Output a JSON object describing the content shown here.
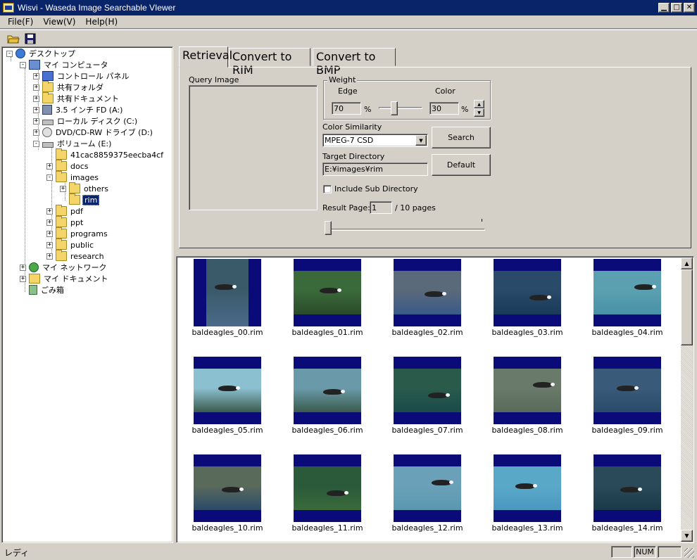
{
  "window": {
    "title": "Wisvi - Waseda Image Searchable VIewer"
  },
  "menu": [
    "File(F)",
    "View(V)",
    "Help(H)"
  ],
  "toolbar": {
    "buttons": [
      "open-folder-icon",
      "save-icon"
    ]
  },
  "tree": [
    {
      "label": "デスクトップ",
      "icon": "desktop-icon",
      "pm": "-",
      "level": 0
    },
    {
      "label": "マイ コンピュータ",
      "icon": "pc-icon",
      "pm": "-",
      "level": 1
    },
    {
      "label": "コントロール パネル",
      "icon": "panel-icon",
      "pm": "+",
      "level": 2
    },
    {
      "label": "共有フォルダ",
      "icon": "folder-icon",
      "pm": "+",
      "level": 2
    },
    {
      "label": "共有ドキュメント",
      "icon": "folder-icon",
      "pm": "+",
      "level": 2
    },
    {
      "label": "3.5 インチ FD (A:)",
      "icon": "floppy-icon",
      "pm": "+",
      "level": 2
    },
    {
      "label": "ローカル ディスク (C:)",
      "icon": "drive-icon",
      "pm": "+",
      "level": 2
    },
    {
      "label": "DVD/CD-RW ドライブ (D:)",
      "icon": "cd-icon",
      "pm": "+",
      "level": 2
    },
    {
      "label": "ボリューム (E:)",
      "icon": "drive-icon",
      "pm": "-",
      "level": 2
    },
    {
      "label": "41cac8859375eecba4cf",
      "icon": "folder-icon",
      "pm": "",
      "level": 3
    },
    {
      "label": "docs",
      "icon": "folder-icon",
      "pm": "+",
      "level": 3
    },
    {
      "label": "images",
      "icon": "folder-icon",
      "pm": "-",
      "level": 3
    },
    {
      "label": "others",
      "icon": "folder-icon",
      "pm": "+",
      "level": 4
    },
    {
      "label": "rim",
      "icon": "folder-icon",
      "pm": "",
      "level": 4,
      "selected": true
    },
    {
      "label": "pdf",
      "icon": "folder-icon",
      "pm": "+",
      "level": 3
    },
    {
      "label": "ppt",
      "icon": "folder-icon",
      "pm": "+",
      "level": 3
    },
    {
      "label": "programs",
      "icon": "folder-icon",
      "pm": "+",
      "level": 3
    },
    {
      "label": "public",
      "icon": "folder-icon",
      "pm": "+",
      "level": 3
    },
    {
      "label": "research",
      "icon": "folder-icon",
      "pm": "+",
      "level": 3
    },
    {
      "label": "マイ ネットワーク",
      "icon": "net-icon",
      "pm": "+",
      "level": 1
    },
    {
      "label": "マイ ドキュメント",
      "icon": "doc-icon",
      "pm": "+",
      "level": 1
    },
    {
      "label": "ごみ箱",
      "icon": "trash-icon",
      "pm": "",
      "level": 1
    }
  ],
  "tabs": [
    "Retrieval",
    "Convert to RIM",
    "Convert to BMP"
  ],
  "retrieval": {
    "query_image_label": "Query Image",
    "weight_label": "Weight",
    "edge_label": "Edge",
    "color_label": "Color",
    "edge_value": "70",
    "color_value": "30",
    "percent": "%",
    "edge_weight_fraction": 0.7,
    "color_similarity_label": "Color Similarity",
    "color_similarity_value": "MPEG-7 CSD",
    "target_directory_label": "Target Directory",
    "target_directory_value": "E:¥images¥rim",
    "include_sub_label": "Include Sub Directory",
    "include_sub_checked": false,
    "result_page_label": "Result Page:",
    "result_page_value": "1",
    "result_page_total": "/ 10 pages",
    "search_button": "Search",
    "default_button": "Default"
  },
  "results": [
    {
      "name": "baldeagles_00.rim",
      "sky": "#3a5a6a",
      "water": "#4a6a8a",
      "portrait": true
    },
    {
      "name": "baldeagles_01.rim",
      "sky": "#3a6a3a",
      "water": "#2a4a2a",
      "portrait": false
    },
    {
      "name": "baldeagles_02.rim",
      "sky": "#5a6a7a",
      "water": "#3a5a8a",
      "portrait": false
    },
    {
      "name": "baldeagles_03.rim",
      "sky": "#2a4a6a",
      "water": "#1a3a5a",
      "portrait": false
    },
    {
      "name": "baldeagles_04.rim",
      "sky": "#5aa0b0",
      "water": "#4a90a8",
      "portrait": false
    },
    {
      "name": "baldeagles_05.rim",
      "sky": "#8ac0d0",
      "water": "#3a5a4a",
      "portrait": false
    },
    {
      "name": "baldeagles_06.rim",
      "sky": "#6a9aaa",
      "water": "#3a5a4a",
      "portrait": false
    },
    {
      "name": "baldeagles_07.rim",
      "sky": "#2a5a4a",
      "water": "#1a4a4a",
      "portrait": false
    },
    {
      "name": "baldeagles_08.rim",
      "sky": "#6a7a6a",
      "water": "#5a6a5a",
      "portrait": false
    },
    {
      "name": "baldeagles_09.rim",
      "sky": "#3a5a7a",
      "water": "#2a4a6a",
      "portrait": false
    },
    {
      "name": "baldeagles_10.rim",
      "sky": "#5a6a5a",
      "water": "#2a4a6a",
      "portrait": false
    },
    {
      "name": "baldeagles_11.rim",
      "sky": "#2a5a3a",
      "water": "#3a6a3a",
      "portrait": false
    },
    {
      "name": "baldeagles_12.rim",
      "sky": "#6aa0b8",
      "water": "#5a98b0",
      "portrait": false
    },
    {
      "name": "baldeagles_13.rim",
      "sky": "#5aa8c8",
      "water": "#4a98c0",
      "portrait": false
    },
    {
      "name": "baldeagles_14.rim",
      "sky": "#2a4a5a",
      "water": "#1a3a4a",
      "portrait": false
    }
  ],
  "status": {
    "text": "レディ",
    "num": "NUM"
  }
}
